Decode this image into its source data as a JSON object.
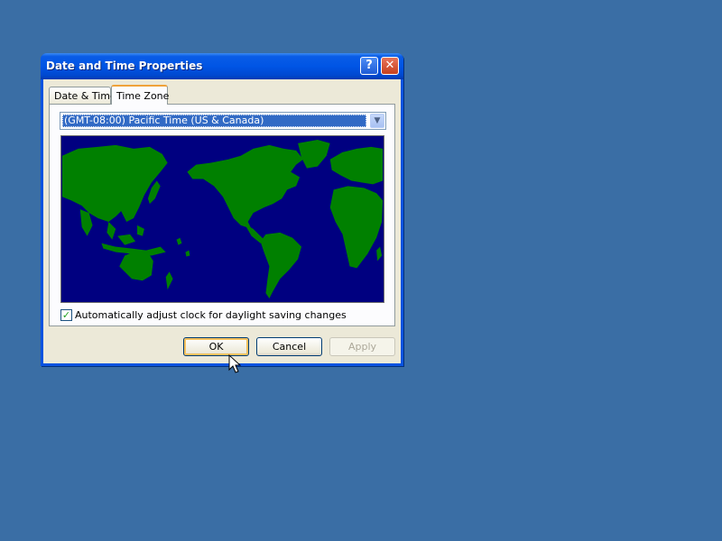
{
  "window": {
    "title": "Date and Time Properties",
    "help_glyph": "?",
    "close_glyph": "✕"
  },
  "tabs": [
    {
      "label": "Date & Time",
      "active": false
    },
    {
      "label": "Time Zone",
      "active": true
    }
  ],
  "timezone": {
    "selected": "(GMT-08:00) Pacific Time (US & Canada)",
    "dropdown_glyph": "▼"
  },
  "map": {
    "ocean_color": "#000080",
    "land_color": "#008000"
  },
  "dst": {
    "checked": true,
    "check_glyph": "✓",
    "label": "Automatically adjust clock for daylight saving changes"
  },
  "buttons": {
    "ok": "OK",
    "cancel": "Cancel",
    "apply": "Apply",
    "apply_enabled": false
  },
  "colors": {
    "desktop": "#3a6ea5",
    "titlebar": "#0055e5",
    "dialog": "#ece9d8"
  }
}
